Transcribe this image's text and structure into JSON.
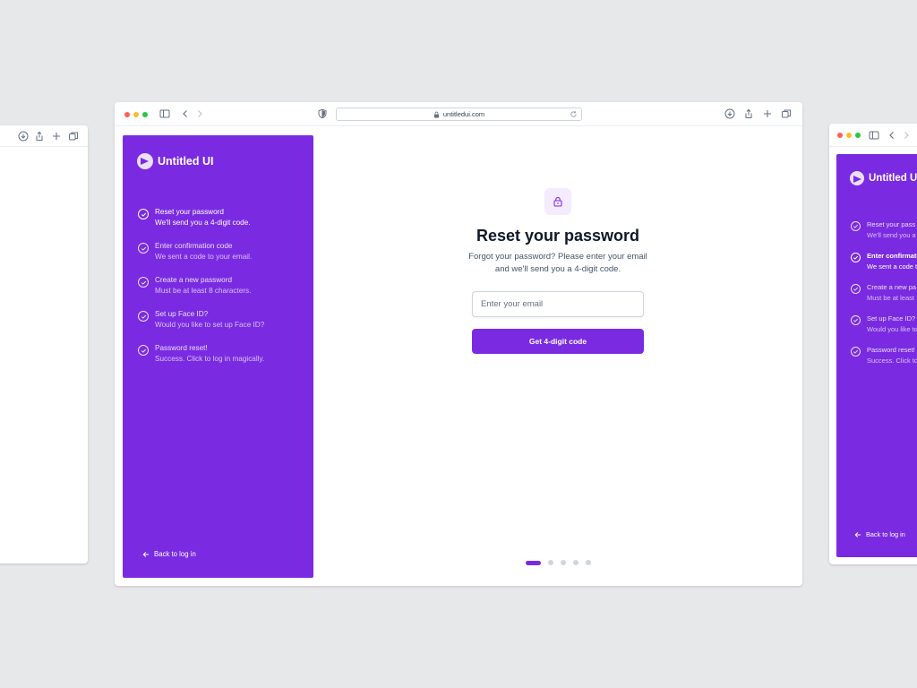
{
  "browser": {
    "url": "untitledui.com"
  },
  "brand": {
    "name": "Untitled UI",
    "accent_color": "#7a2be2"
  },
  "steps": [
    {
      "title": "Reset your password",
      "desc": "We'll send you a 4-digit code."
    },
    {
      "title": "Enter confirmation code",
      "desc": "We sent a code to your email."
    },
    {
      "title": "Create a new password",
      "desc": "Must be at least 8 characters."
    },
    {
      "title": "Set up Face ID?",
      "desc": "Would you like to set up Face ID?"
    },
    {
      "title": "Password reset!",
      "desc": "Success. Click to log in magically."
    }
  ],
  "right_steps": [
    {
      "title": "Reset your pass",
      "desc": "We'll send you a"
    },
    {
      "title": "Enter confirmati",
      "desc": "We sent a code t"
    },
    {
      "title": "Create a new pa",
      "desc": "Must be at least"
    },
    {
      "title": "Set up Face ID?",
      "desc": "Would you like to"
    },
    {
      "title": "Password reset!",
      "desc": "Success. Click to"
    }
  ],
  "back_link": "Back to log in",
  "main": {
    "title": "Reset your password",
    "subtitle": "Forgot your password? Please enter your email and we'll send you a 4-digit code.",
    "email_placeholder": "Enter your email",
    "email_value": "",
    "submit_label": "Get 4-digit code"
  },
  "pagination": {
    "total": 5,
    "current": 1
  },
  "icons": [
    "sidebar-toggle-icon",
    "back-arrow-icon",
    "forward-arrow-icon",
    "shield-icon",
    "lock-icon",
    "reload-icon",
    "download-icon",
    "share-icon",
    "new-tab-icon",
    "tabs-overview-icon",
    "check-circle-icon",
    "arrow-left-icon",
    "padlock-icon"
  ]
}
